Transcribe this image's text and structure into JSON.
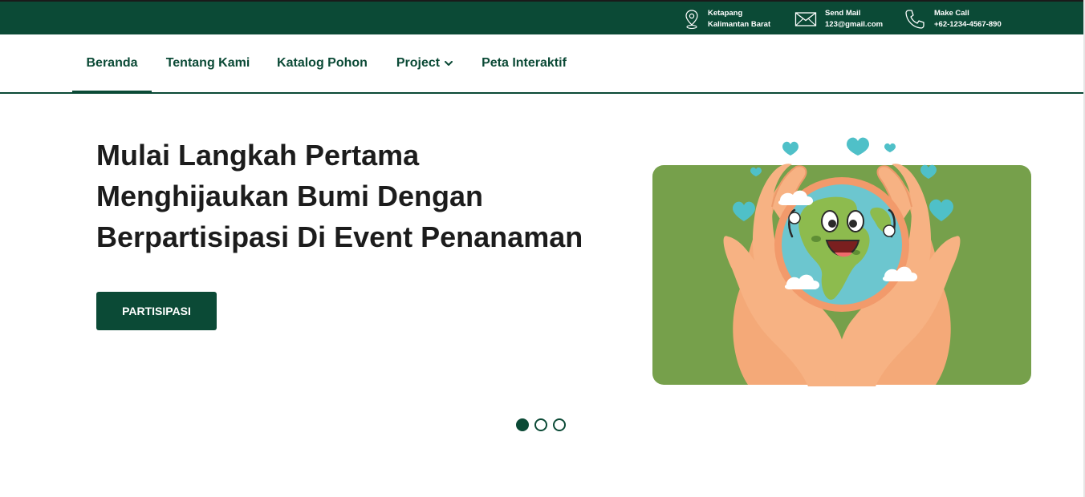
{
  "topbar": {
    "location": {
      "icon": "location-pin-icon",
      "line1": "Ketapang",
      "line2": "Kalimantan Barat"
    },
    "mail": {
      "icon": "envelope-icon",
      "line1": "Send Mail",
      "line2": "123@gmail.com"
    },
    "phone": {
      "icon": "phone-icon",
      "line1": "Make Call",
      "line2": "+62-1234-4567-890"
    }
  },
  "nav": {
    "items": [
      {
        "label": "Beranda",
        "active": true
      },
      {
        "label": "Tentang Kami",
        "active": false
      },
      {
        "label": "Katalog Pohon",
        "active": false
      },
      {
        "label": "Project",
        "active": false,
        "icon": "chevron-down-icon"
      },
      {
        "label": "Peta Interaktif",
        "active": false
      }
    ]
  },
  "hero": {
    "title": "Mulai Langkah Pertama Menghijaukan Bumi Dengan Berpartisipasi Di Event Penanaman",
    "button_label": "PARTISIPASI",
    "illustration": "hands-holding-earth-illustration"
  },
  "carousel": {
    "slide_count": 3,
    "active_index": 0
  },
  "colors": {
    "primary": "#0b4a36",
    "illustration_bg": "#76a04b",
    "heart": "#4fc0c8",
    "skin": "#f7b283",
    "ocean": "#6cc6cf",
    "land": "#8dbb4e"
  }
}
